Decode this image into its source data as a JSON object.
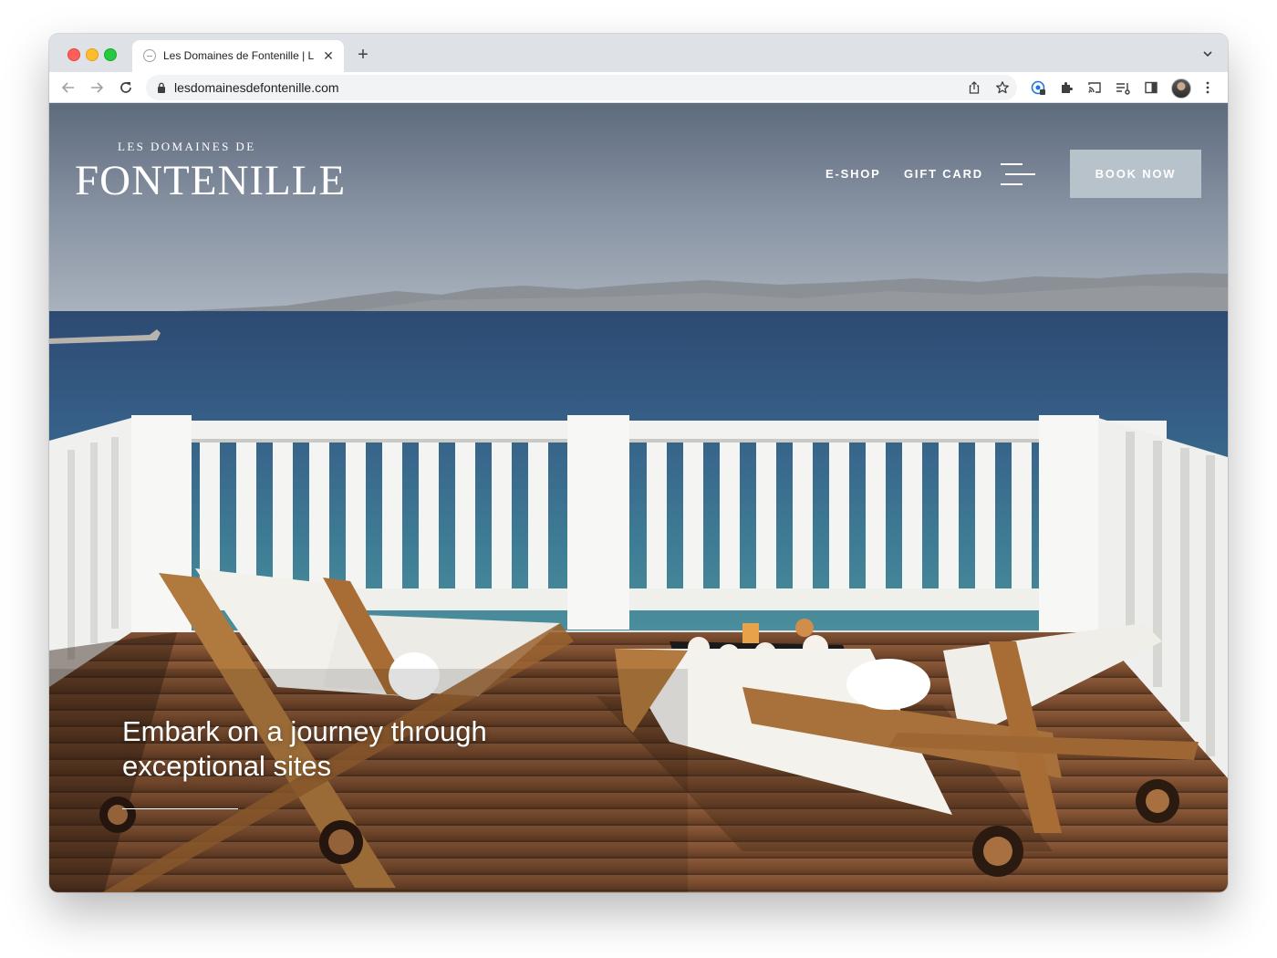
{
  "browser": {
    "tab_title": "Les Domaines de Fontenille | Lu",
    "url": "lesdomainesdefontenille.com",
    "new_tab_label": "+",
    "close_label": "✕",
    "accent_color": "#1a73e8"
  },
  "site": {
    "logo_top": "LES DOMAINES DE",
    "logo_main": "FONTENILLE",
    "nav": {
      "eshop": "E-SHOP",
      "gift_card": "GIFT CARD"
    },
    "book_now": "BOOK NOW",
    "book_button_color": "#b8c2cb",
    "hero": {
      "headline_line1": "Embark on a journey through",
      "headline_line2": "exceptional sites"
    }
  },
  "icons": [
    "back-arrow-icon",
    "forward-arrow-icon",
    "reload-icon",
    "lock-icon",
    "share-icon",
    "star-icon",
    "extension-icon",
    "puzzle-icon",
    "cast-icon",
    "reading-list-icon",
    "side-panel-icon",
    "profile-avatar",
    "more-vert-icon",
    "tab-search-icon",
    "menu-icon"
  ]
}
